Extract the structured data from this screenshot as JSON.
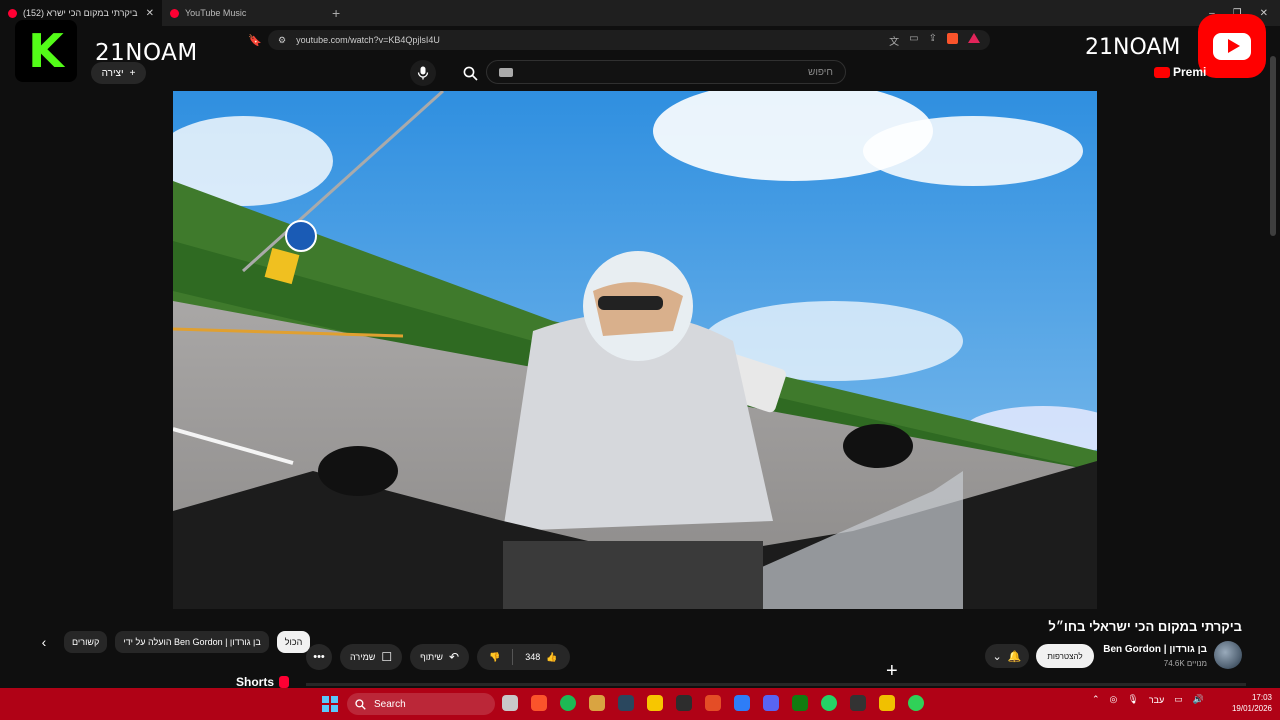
{
  "browser": {
    "tabs": [
      {
        "title": "(152) ביקרתי במקום הכי ישרא",
        "active": true
      },
      {
        "title": "YouTube Music",
        "active": false
      }
    ],
    "url": "youtube.com/watch?v=KB4QpjlsI4U",
    "window_controls": [
      "–",
      "❐",
      "✕"
    ]
  },
  "overlay": {
    "left_brand": "21NOAM",
    "right_brand": "21NOAM",
    "kick_letter": "K"
  },
  "header": {
    "create_label": "יצירה",
    "search_placeholder": "חיפוש",
    "premium_label": "Premi"
  },
  "video": {
    "title": "ביקרתי במקום הכי ישראלי בחו״ל",
    "channel_name": "Ben Gordon | בן גורדון",
    "subscribers": "74.6K מנויים",
    "subscribe_label": "להצטרפות",
    "like_count": "348",
    "share_label": "שיתוף",
    "save_label": "שמירה"
  },
  "chips": {
    "all": "הכול",
    "uploaded_by": "הועלה על ידי Ben Gordon | בן גורדון",
    "related": "קשורים"
  },
  "shorts_label": "Shorts",
  "taskbar": {
    "search_label": "Search",
    "language": "עבר",
    "time": "17:03",
    "date": "19/01/2026",
    "app_colors": [
      "#c8c8c8",
      "#fb542b",
      "#1db954",
      "#d9a441",
      "#2a475e",
      "#f7c600",
      "#2d2d2d",
      "#e44d26",
      "#2e7df7",
      "#5865f2",
      "#107c10",
      "#25d366",
      "#333333",
      "#f0c000",
      "#30d158"
    ]
  }
}
